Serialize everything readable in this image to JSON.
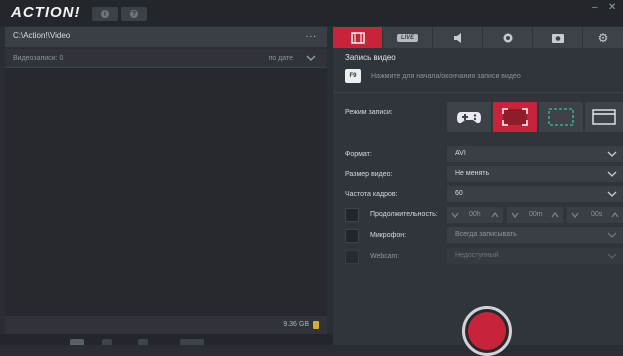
{
  "app": {
    "logo": "ACTION!"
  },
  "left_panel": {
    "path": "C:\\Action!\\Video",
    "more": "...",
    "recordings_count": "Видеозаписи: 0",
    "sort_label": "по дате",
    "storage": "9.36 GB"
  },
  "tabs": [
    {
      "name": "video-tab",
      "icon": "film-icon",
      "label": ""
    },
    {
      "name": "live-tab",
      "icon": "live-badge-icon",
      "label": "LIVE"
    },
    {
      "name": "audio-tab",
      "icon": "speaker-icon",
      "label": ""
    },
    {
      "name": "webcam-tab",
      "icon": "webcam-icon",
      "label": ""
    },
    {
      "name": "screenshot-tab",
      "icon": "camera-icon",
      "label": ""
    },
    {
      "name": "settings-tab",
      "icon": "gear-icon",
      "label": ""
    }
  ],
  "record": {
    "title": "Запись видео",
    "hotkey": "F9",
    "hint": "Нажмите для начала/окончания записи видео",
    "mode_label": "Режим записи:",
    "format_label": "Формат:",
    "format_value": "AVI",
    "size_label": "Размер видео:",
    "size_value": "Не менять",
    "fps_label": "Частота кадров:",
    "fps_value": "60",
    "duration_label": "Продолжительность:",
    "duration_h": "00h",
    "duration_m": "00m",
    "duration_s": "00s",
    "mic_label": "Микрофон:",
    "mic_value": "Всегда записывать",
    "webcam_label": "Webcam:",
    "webcam_value": "Недоступный"
  },
  "colors": {
    "accent": "#c7243a",
    "panel": "#30353b",
    "bg": "#2a2e34"
  }
}
